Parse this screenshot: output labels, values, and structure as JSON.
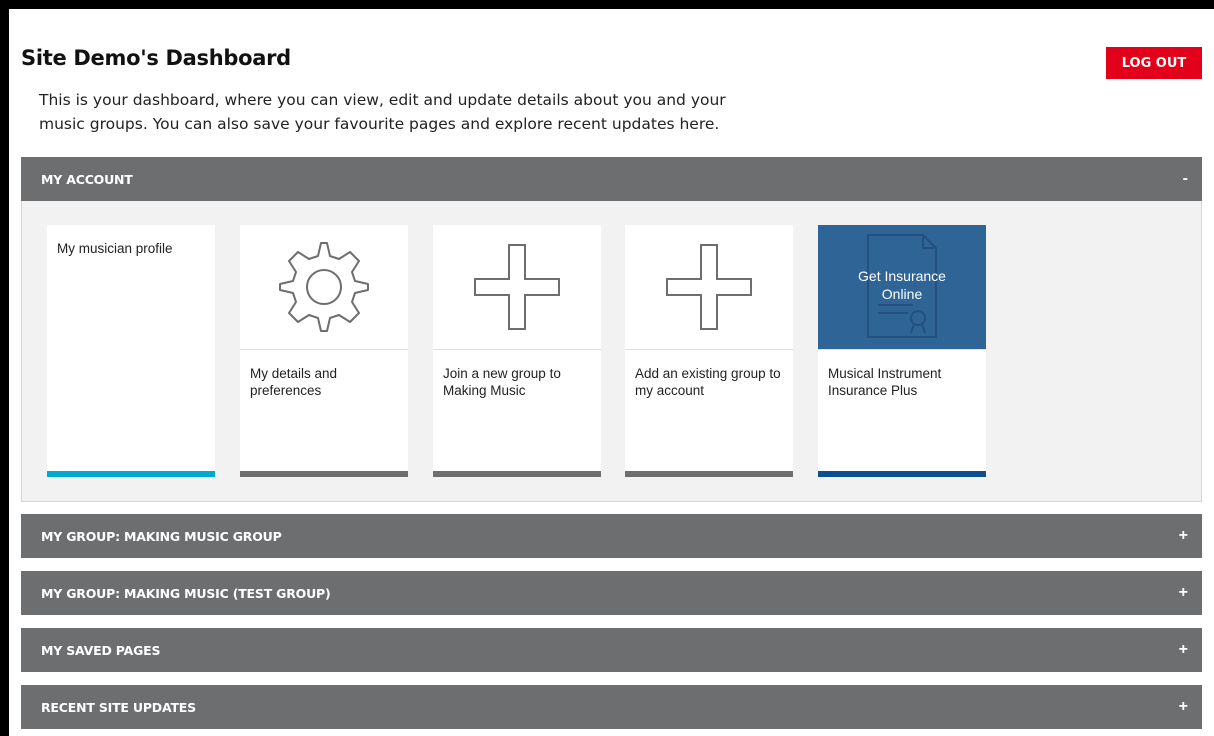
{
  "page": {
    "title": "Site Demo's Dashboard",
    "logout_label": "LOG OUT",
    "intro_line1": "This is your dashboard, where you can view, edit and update details about you and your",
    "intro_line2": "music groups. You can also save your favourite pages and explore recent updates here."
  },
  "colors": {
    "panel_header": "#6d6e70",
    "logout": "#e2001a",
    "accent_cyan": "#00a9d4",
    "accent_navy": "#0b4f91",
    "insurance_tile": "#2f6497"
  },
  "panels": [
    {
      "title": "MY ACCOUNT",
      "toggle": "-",
      "expanded": true
    },
    {
      "title": "MY GROUP: MAKING MUSIC GROUP",
      "toggle": "+"
    },
    {
      "title": "MY GROUP: MAKING MUSIC (TEST GROUP)",
      "toggle": "+"
    },
    {
      "title": "MY SAVED PAGES",
      "toggle": "+"
    },
    {
      "title": "RECENT SITE UPDATES",
      "toggle": "+"
    }
  ],
  "tiles": [
    {
      "label": "My musician profile",
      "icon": "none"
    },
    {
      "label": "My details and preferences",
      "icon": "gear-icon"
    },
    {
      "label": "Join a new group to Making Music",
      "icon": "plus-icon"
    },
    {
      "label": "Add an existing group to my account",
      "icon": "plus-icon"
    },
    {
      "label": "Musical Instrument Insurance Plus",
      "icon": "certificate-icon",
      "overlay_line1": "Get Insurance",
      "overlay_line2": "Online"
    }
  ]
}
